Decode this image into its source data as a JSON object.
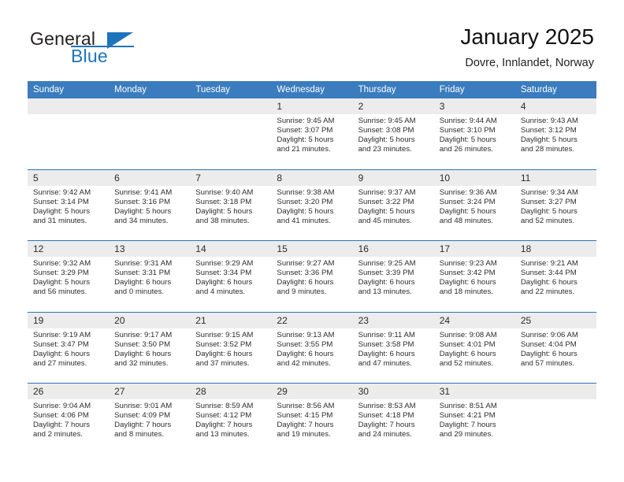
{
  "brand": {
    "name_part1": "General",
    "name_part2": "Blue",
    "flag_icon": "triangle-flag-icon",
    "accent_color": "#1d74bb"
  },
  "header": {
    "title": "January 2025",
    "subtitle": "Dovre, Innlandet, Norway"
  },
  "theme": {
    "header_row_bg": "#3a7cbe",
    "daynum_bg": "#ececec",
    "week_divider": "#2e74b5",
    "text": "#2d2d2d"
  },
  "calendar": {
    "weekday_headers": [
      "Sunday",
      "Monday",
      "Tuesday",
      "Wednesday",
      "Thursday",
      "Friday",
      "Saturday"
    ],
    "weeks": [
      {
        "days": [
          {
            "number": "",
            "sunrise": "",
            "sunset": "",
            "daylight_line1": "",
            "daylight_line2": ""
          },
          {
            "number": "",
            "sunrise": "",
            "sunset": "",
            "daylight_line1": "",
            "daylight_line2": ""
          },
          {
            "number": "",
            "sunrise": "",
            "sunset": "",
            "daylight_line1": "",
            "daylight_line2": ""
          },
          {
            "number": "1",
            "sunrise": "Sunrise: 9:45 AM",
            "sunset": "Sunset: 3:07 PM",
            "daylight_line1": "Daylight: 5 hours",
            "daylight_line2": "and 21 minutes."
          },
          {
            "number": "2",
            "sunrise": "Sunrise: 9:45 AM",
            "sunset": "Sunset: 3:08 PM",
            "daylight_line1": "Daylight: 5 hours",
            "daylight_line2": "and 23 minutes."
          },
          {
            "number": "3",
            "sunrise": "Sunrise: 9:44 AM",
            "sunset": "Sunset: 3:10 PM",
            "daylight_line1": "Daylight: 5 hours",
            "daylight_line2": "and 26 minutes."
          },
          {
            "number": "4",
            "sunrise": "Sunrise: 9:43 AM",
            "sunset": "Sunset: 3:12 PM",
            "daylight_line1": "Daylight: 5 hours",
            "daylight_line2": "and 28 minutes."
          }
        ]
      },
      {
        "days": [
          {
            "number": "5",
            "sunrise": "Sunrise: 9:42 AM",
            "sunset": "Sunset: 3:14 PM",
            "daylight_line1": "Daylight: 5 hours",
            "daylight_line2": "and 31 minutes."
          },
          {
            "number": "6",
            "sunrise": "Sunrise: 9:41 AM",
            "sunset": "Sunset: 3:16 PM",
            "daylight_line1": "Daylight: 5 hours",
            "daylight_line2": "and 34 minutes."
          },
          {
            "number": "7",
            "sunrise": "Sunrise: 9:40 AM",
            "sunset": "Sunset: 3:18 PM",
            "daylight_line1": "Daylight: 5 hours",
            "daylight_line2": "and 38 minutes."
          },
          {
            "number": "8",
            "sunrise": "Sunrise: 9:38 AM",
            "sunset": "Sunset: 3:20 PM",
            "daylight_line1": "Daylight: 5 hours",
            "daylight_line2": "and 41 minutes."
          },
          {
            "number": "9",
            "sunrise": "Sunrise: 9:37 AM",
            "sunset": "Sunset: 3:22 PM",
            "daylight_line1": "Daylight: 5 hours",
            "daylight_line2": "and 45 minutes."
          },
          {
            "number": "10",
            "sunrise": "Sunrise: 9:36 AM",
            "sunset": "Sunset: 3:24 PM",
            "daylight_line1": "Daylight: 5 hours",
            "daylight_line2": "and 48 minutes."
          },
          {
            "number": "11",
            "sunrise": "Sunrise: 9:34 AM",
            "sunset": "Sunset: 3:27 PM",
            "daylight_line1": "Daylight: 5 hours",
            "daylight_line2": "and 52 minutes."
          }
        ]
      },
      {
        "days": [
          {
            "number": "12",
            "sunrise": "Sunrise: 9:32 AM",
            "sunset": "Sunset: 3:29 PM",
            "daylight_line1": "Daylight: 5 hours",
            "daylight_line2": "and 56 minutes."
          },
          {
            "number": "13",
            "sunrise": "Sunrise: 9:31 AM",
            "sunset": "Sunset: 3:31 PM",
            "daylight_line1": "Daylight: 6 hours",
            "daylight_line2": "and 0 minutes."
          },
          {
            "number": "14",
            "sunrise": "Sunrise: 9:29 AM",
            "sunset": "Sunset: 3:34 PM",
            "daylight_line1": "Daylight: 6 hours",
            "daylight_line2": "and 4 minutes."
          },
          {
            "number": "15",
            "sunrise": "Sunrise: 9:27 AM",
            "sunset": "Sunset: 3:36 PM",
            "daylight_line1": "Daylight: 6 hours",
            "daylight_line2": "and 9 minutes."
          },
          {
            "number": "16",
            "sunrise": "Sunrise: 9:25 AM",
            "sunset": "Sunset: 3:39 PM",
            "daylight_line1": "Daylight: 6 hours",
            "daylight_line2": "and 13 minutes."
          },
          {
            "number": "17",
            "sunrise": "Sunrise: 9:23 AM",
            "sunset": "Sunset: 3:42 PM",
            "daylight_line1": "Daylight: 6 hours",
            "daylight_line2": "and 18 minutes."
          },
          {
            "number": "18",
            "sunrise": "Sunrise: 9:21 AM",
            "sunset": "Sunset: 3:44 PM",
            "daylight_line1": "Daylight: 6 hours",
            "daylight_line2": "and 22 minutes."
          }
        ]
      },
      {
        "days": [
          {
            "number": "19",
            "sunrise": "Sunrise: 9:19 AM",
            "sunset": "Sunset: 3:47 PM",
            "daylight_line1": "Daylight: 6 hours",
            "daylight_line2": "and 27 minutes."
          },
          {
            "number": "20",
            "sunrise": "Sunrise: 9:17 AM",
            "sunset": "Sunset: 3:50 PM",
            "daylight_line1": "Daylight: 6 hours",
            "daylight_line2": "and 32 minutes."
          },
          {
            "number": "21",
            "sunrise": "Sunrise: 9:15 AM",
            "sunset": "Sunset: 3:52 PM",
            "daylight_line1": "Daylight: 6 hours",
            "daylight_line2": "and 37 minutes."
          },
          {
            "number": "22",
            "sunrise": "Sunrise: 9:13 AM",
            "sunset": "Sunset: 3:55 PM",
            "daylight_line1": "Daylight: 6 hours",
            "daylight_line2": "and 42 minutes."
          },
          {
            "number": "23",
            "sunrise": "Sunrise: 9:11 AM",
            "sunset": "Sunset: 3:58 PM",
            "daylight_line1": "Daylight: 6 hours",
            "daylight_line2": "and 47 minutes."
          },
          {
            "number": "24",
            "sunrise": "Sunrise: 9:08 AM",
            "sunset": "Sunset: 4:01 PM",
            "daylight_line1": "Daylight: 6 hours",
            "daylight_line2": "and 52 minutes."
          },
          {
            "number": "25",
            "sunrise": "Sunrise: 9:06 AM",
            "sunset": "Sunset: 4:04 PM",
            "daylight_line1": "Daylight: 6 hours",
            "daylight_line2": "and 57 minutes."
          }
        ]
      },
      {
        "days": [
          {
            "number": "26",
            "sunrise": "Sunrise: 9:04 AM",
            "sunset": "Sunset: 4:06 PM",
            "daylight_line1": "Daylight: 7 hours",
            "daylight_line2": "and 2 minutes."
          },
          {
            "number": "27",
            "sunrise": "Sunrise: 9:01 AM",
            "sunset": "Sunset: 4:09 PM",
            "daylight_line1": "Daylight: 7 hours",
            "daylight_line2": "and 8 minutes."
          },
          {
            "number": "28",
            "sunrise": "Sunrise: 8:59 AM",
            "sunset": "Sunset: 4:12 PM",
            "daylight_line1": "Daylight: 7 hours",
            "daylight_line2": "and 13 minutes."
          },
          {
            "number": "29",
            "sunrise": "Sunrise: 8:56 AM",
            "sunset": "Sunset: 4:15 PM",
            "daylight_line1": "Daylight: 7 hours",
            "daylight_line2": "and 19 minutes."
          },
          {
            "number": "30",
            "sunrise": "Sunrise: 8:53 AM",
            "sunset": "Sunset: 4:18 PM",
            "daylight_line1": "Daylight: 7 hours",
            "daylight_line2": "and 24 minutes."
          },
          {
            "number": "31",
            "sunrise": "Sunrise: 8:51 AM",
            "sunset": "Sunset: 4:21 PM",
            "daylight_line1": "Daylight: 7 hours",
            "daylight_line2": "and 29 minutes."
          },
          {
            "number": "",
            "sunrise": "",
            "sunset": "",
            "daylight_line1": "",
            "daylight_line2": ""
          }
        ]
      }
    ]
  }
}
